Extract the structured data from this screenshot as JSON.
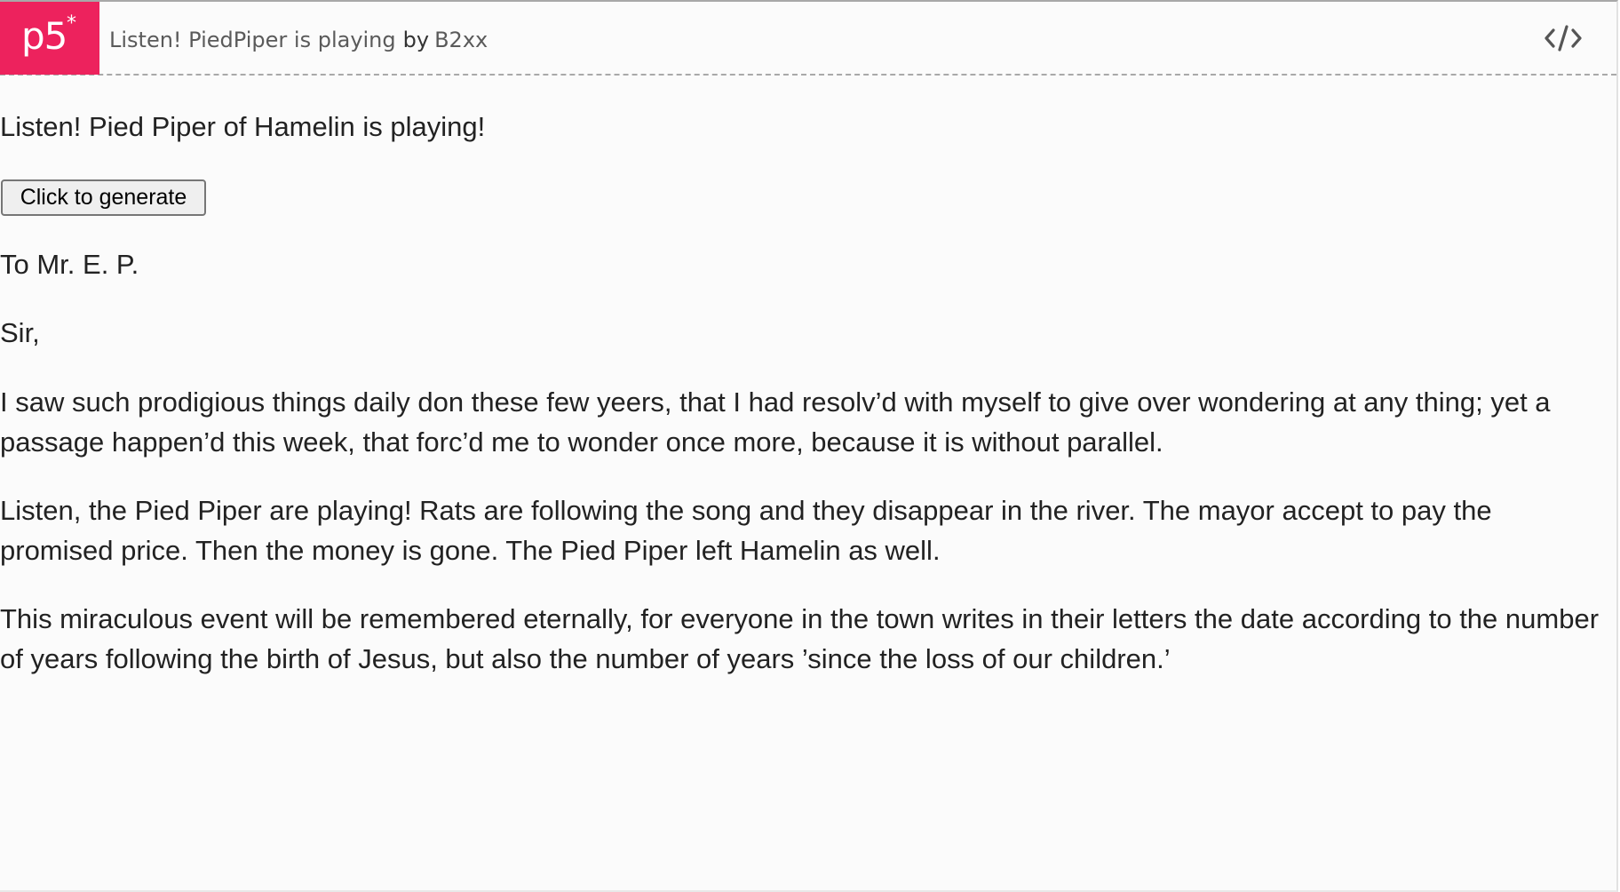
{
  "header": {
    "logo_text": "p5",
    "logo_star": "*",
    "sketch_title": "Listen! PiedPiper is playing",
    "by_label": "by",
    "author": "B2xx",
    "code_icon": "code-brackets-icon"
  },
  "colors": {
    "brand": "#ed225d",
    "page_background": "#fbfbfb",
    "text": "#222222",
    "header_text": "#5a5a5a"
  },
  "main": {
    "intro": "Listen! Pied Piper of Hamelin is playing!",
    "button_label": "Click to generate",
    "salutation": "To Mr. E. P.",
    "greeting": "Sir,",
    "paragraphs": [
      "I saw such prodigious things daily don these few yeers, that I had resolv’d with myself to give over wondering at any thing; yet a passage happen’d this week, that forc’d me to wonder once more, because it is without parallel.",
      "Listen, the Pied Piper are playing! Rats are following the song and they disappear in the river. The mayor accept to pay the promised price. Then the money is gone. The Pied Piper left Hamelin as well.",
      "This miraculous event will be remembered eternally, for everyone in the town writes in their letters the date according to the number of years following the birth of Jesus, but also the number of years ’since the loss of our children.’"
    ]
  }
}
